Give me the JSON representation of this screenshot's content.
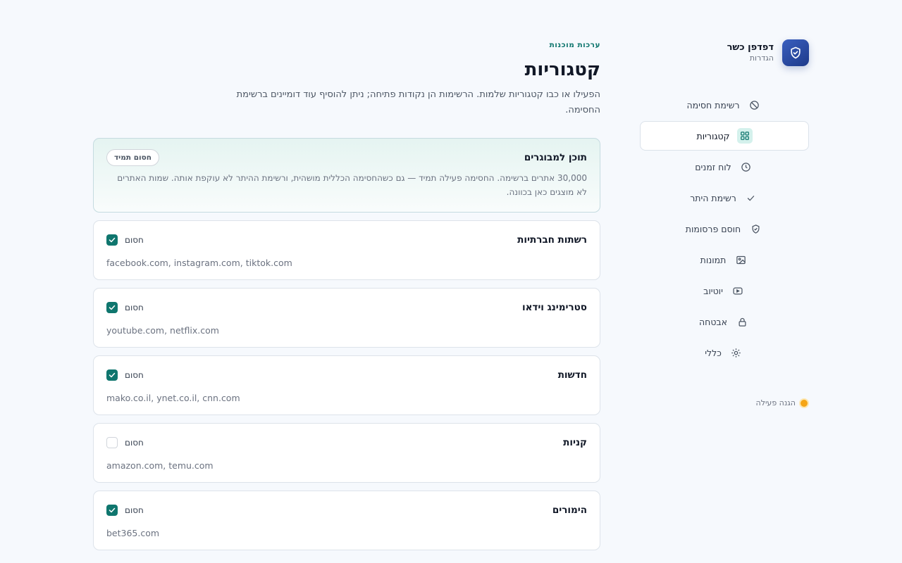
{
  "brand": {
    "title": "דפדפן כשר",
    "subtitle": "הגדרות"
  },
  "nav": {
    "items": [
      {
        "label": "רשימת חסימה",
        "icon": "block-icon"
      },
      {
        "label": "קטגוריות",
        "icon": "grid-icon",
        "active": true
      },
      {
        "label": "לוח זמנים",
        "icon": "clock-icon"
      },
      {
        "label": "רשימת היתר",
        "icon": "check-icon"
      },
      {
        "label": "חוסם פרסומות",
        "icon": "shield-icon"
      },
      {
        "label": "תמונות",
        "icon": "image-icon"
      },
      {
        "label": "יוטיוב",
        "icon": "youtube-icon"
      },
      {
        "label": "אבטחה",
        "icon": "lock-icon"
      },
      {
        "label": "כללי",
        "icon": "sun-icon"
      }
    ]
  },
  "status": {
    "label": "הגנה פעילה",
    "color": "#f5a516"
  },
  "header": {
    "eyebrow": "ערכות מוכנות",
    "title": "קטגוריות",
    "description": "הפעילו או כבו קטגוריות שלמות. הרשימות הן נקודות פתיחה; ניתן להוסיף עוד דומיינים ברשימת החסימה."
  },
  "featured": {
    "title": "תוכן למבוגרים",
    "badge": "חסום תמיד",
    "description": "30,000 אתרים ברשימה. החסימה פעילה תמיד — גם כשהחסימה הכללית מושהית, ורשימת ההיתר לא עוקפת אותה. שמות האתרים לא מוצגים כאן בכוונה."
  },
  "categories": [
    {
      "title": "רשתות חברתיות",
      "domains": "facebook.com, instagram.com, tiktok.com",
      "toggle_label": "חסום",
      "checked": true
    },
    {
      "title": "סטרימינג וידאו",
      "domains": "youtube.com, netflix.com",
      "toggle_label": "חסום",
      "checked": true
    },
    {
      "title": "חדשות",
      "domains": "mako.co.il, ynet.co.il, cnn.com",
      "toggle_label": "חסום",
      "checked": true
    },
    {
      "title": "קניות",
      "domains": "amazon.com, temu.com",
      "toggle_label": "חסום",
      "checked": false
    },
    {
      "title": "הימורים",
      "domains": "bet365.com",
      "toggle_label": "חסום",
      "checked": true
    }
  ],
  "colors": {
    "accent": "#0f766e",
    "brand": "#1e3a8a"
  }
}
